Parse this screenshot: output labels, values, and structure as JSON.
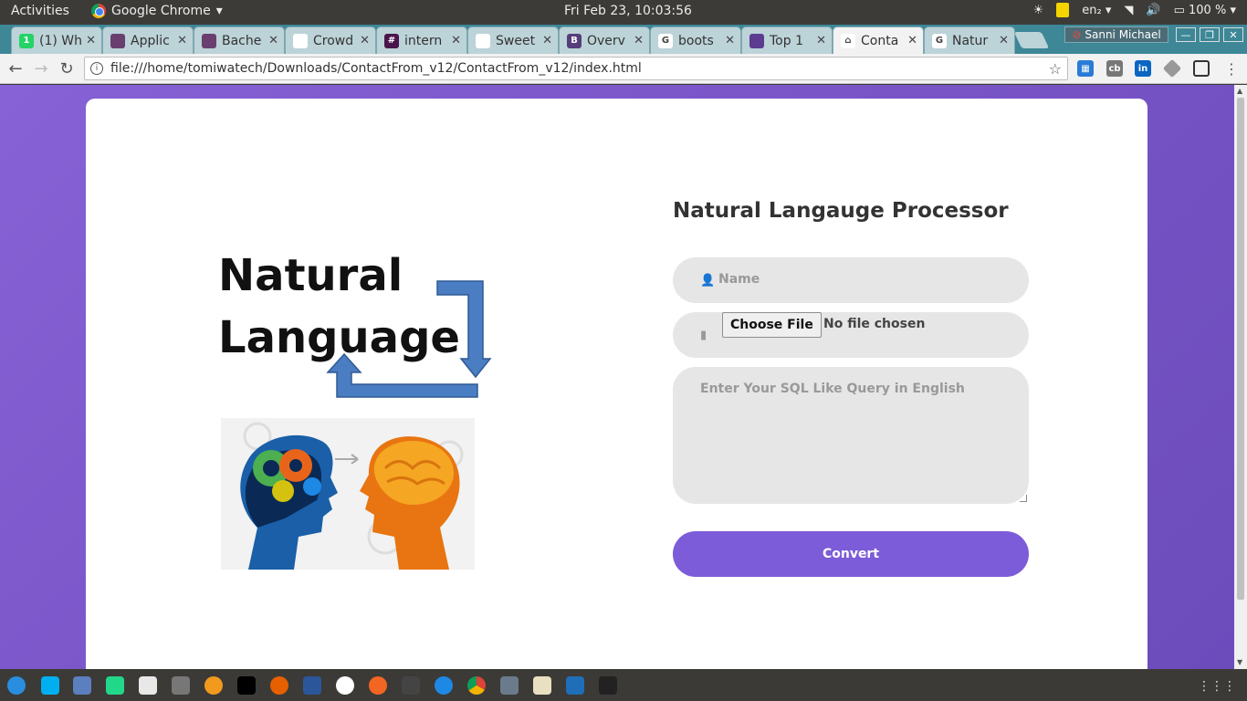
{
  "system": {
    "activities": "Activities",
    "app_name": "Google Chrome",
    "clock": "Fri Feb 23, 10:03:56",
    "lang": "en₂",
    "battery": "100 %"
  },
  "tabs": [
    {
      "title": "(1) Wh",
      "color": "#25d366",
      "glyph": "1"
    },
    {
      "title": "Applic",
      "color": "#6a3f6f",
      "glyph": ""
    },
    {
      "title": "Bache",
      "color": "#6a3f6f",
      "glyph": ""
    },
    {
      "title": "Crowd",
      "color": "#ffffff",
      "glyph": ""
    },
    {
      "title": "intern",
      "color": "#4a154b",
      "glyph": "#"
    },
    {
      "title": "Sweet",
      "color": "#ffffff",
      "glyph": ""
    },
    {
      "title": "Overv",
      "color": "#563d7c",
      "glyph": "B"
    },
    {
      "title": "boots",
      "color": "#ffffff",
      "glyph": "G"
    },
    {
      "title": "Top 1",
      "color": "#5c3b90",
      "glyph": ""
    },
    {
      "title": "Conta",
      "color": "#ffffff",
      "glyph": "⌂",
      "active": true
    },
    {
      "title": "Natur",
      "color": "#ffffff",
      "glyph": "G"
    }
  ],
  "profile_name": "Sanni Michael",
  "url": "file:///home/tomiwatech/Downloads/ContactFrom_v12/ContactFrom_v12/index.html",
  "hero": {
    "line1": "Natural",
    "line2": "Language"
  },
  "form": {
    "title": "Natural Langauge Processor",
    "name_placeholder": "Name",
    "file_button": "Choose File",
    "file_status": "No file chosen",
    "query_placeholder": "Enter Your SQL Like Query in English",
    "submit": "Convert"
  },
  "colors": {
    "accent": "#7c5cd8",
    "background": "#8662d6"
  }
}
